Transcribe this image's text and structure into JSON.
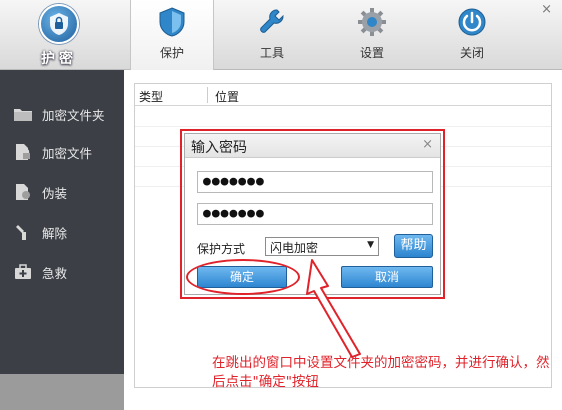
{
  "app": {
    "logo_text": "护密",
    "window_close": "×"
  },
  "toolbar": {
    "tabs": [
      {
        "label": "保护",
        "icon": "shield-icon"
      },
      {
        "label": "工具",
        "icon": "wrench-icon"
      },
      {
        "label": "设置",
        "icon": "gear-icon"
      },
      {
        "label": "关闭",
        "icon": "power-icon"
      }
    ],
    "active_tab": "保护"
  },
  "sidebar": {
    "items": [
      {
        "label": "加密文件夹",
        "icon": "folder-icon"
      },
      {
        "label": "加密文件",
        "icon": "file-lock-icon"
      },
      {
        "label": "伪装",
        "icon": "disguise-icon"
      },
      {
        "label": "解除",
        "icon": "unlock-icon"
      },
      {
        "label": "急救",
        "icon": "first-aid-icon"
      }
    ]
  },
  "list": {
    "columns": [
      "类型",
      "位置"
    ]
  },
  "dialog": {
    "title": "输入密码",
    "close": "×",
    "password_1": "●●●●●●●",
    "password_2": "●●●●●●●",
    "mode_label": "保护方式",
    "mode_value": "闪电加密",
    "help_label": "帮助",
    "ok_label": "确定",
    "cancel_label": "取消"
  },
  "annotation": {
    "text": "在跳出的窗口中设置文件夹的加密密码，并进行确认，然后点击\"确定\"按钮"
  },
  "colors": {
    "sidebar_bg": "#3c4046",
    "accent_blue": "#2e86d0",
    "annotation_red": "#e0232b"
  }
}
